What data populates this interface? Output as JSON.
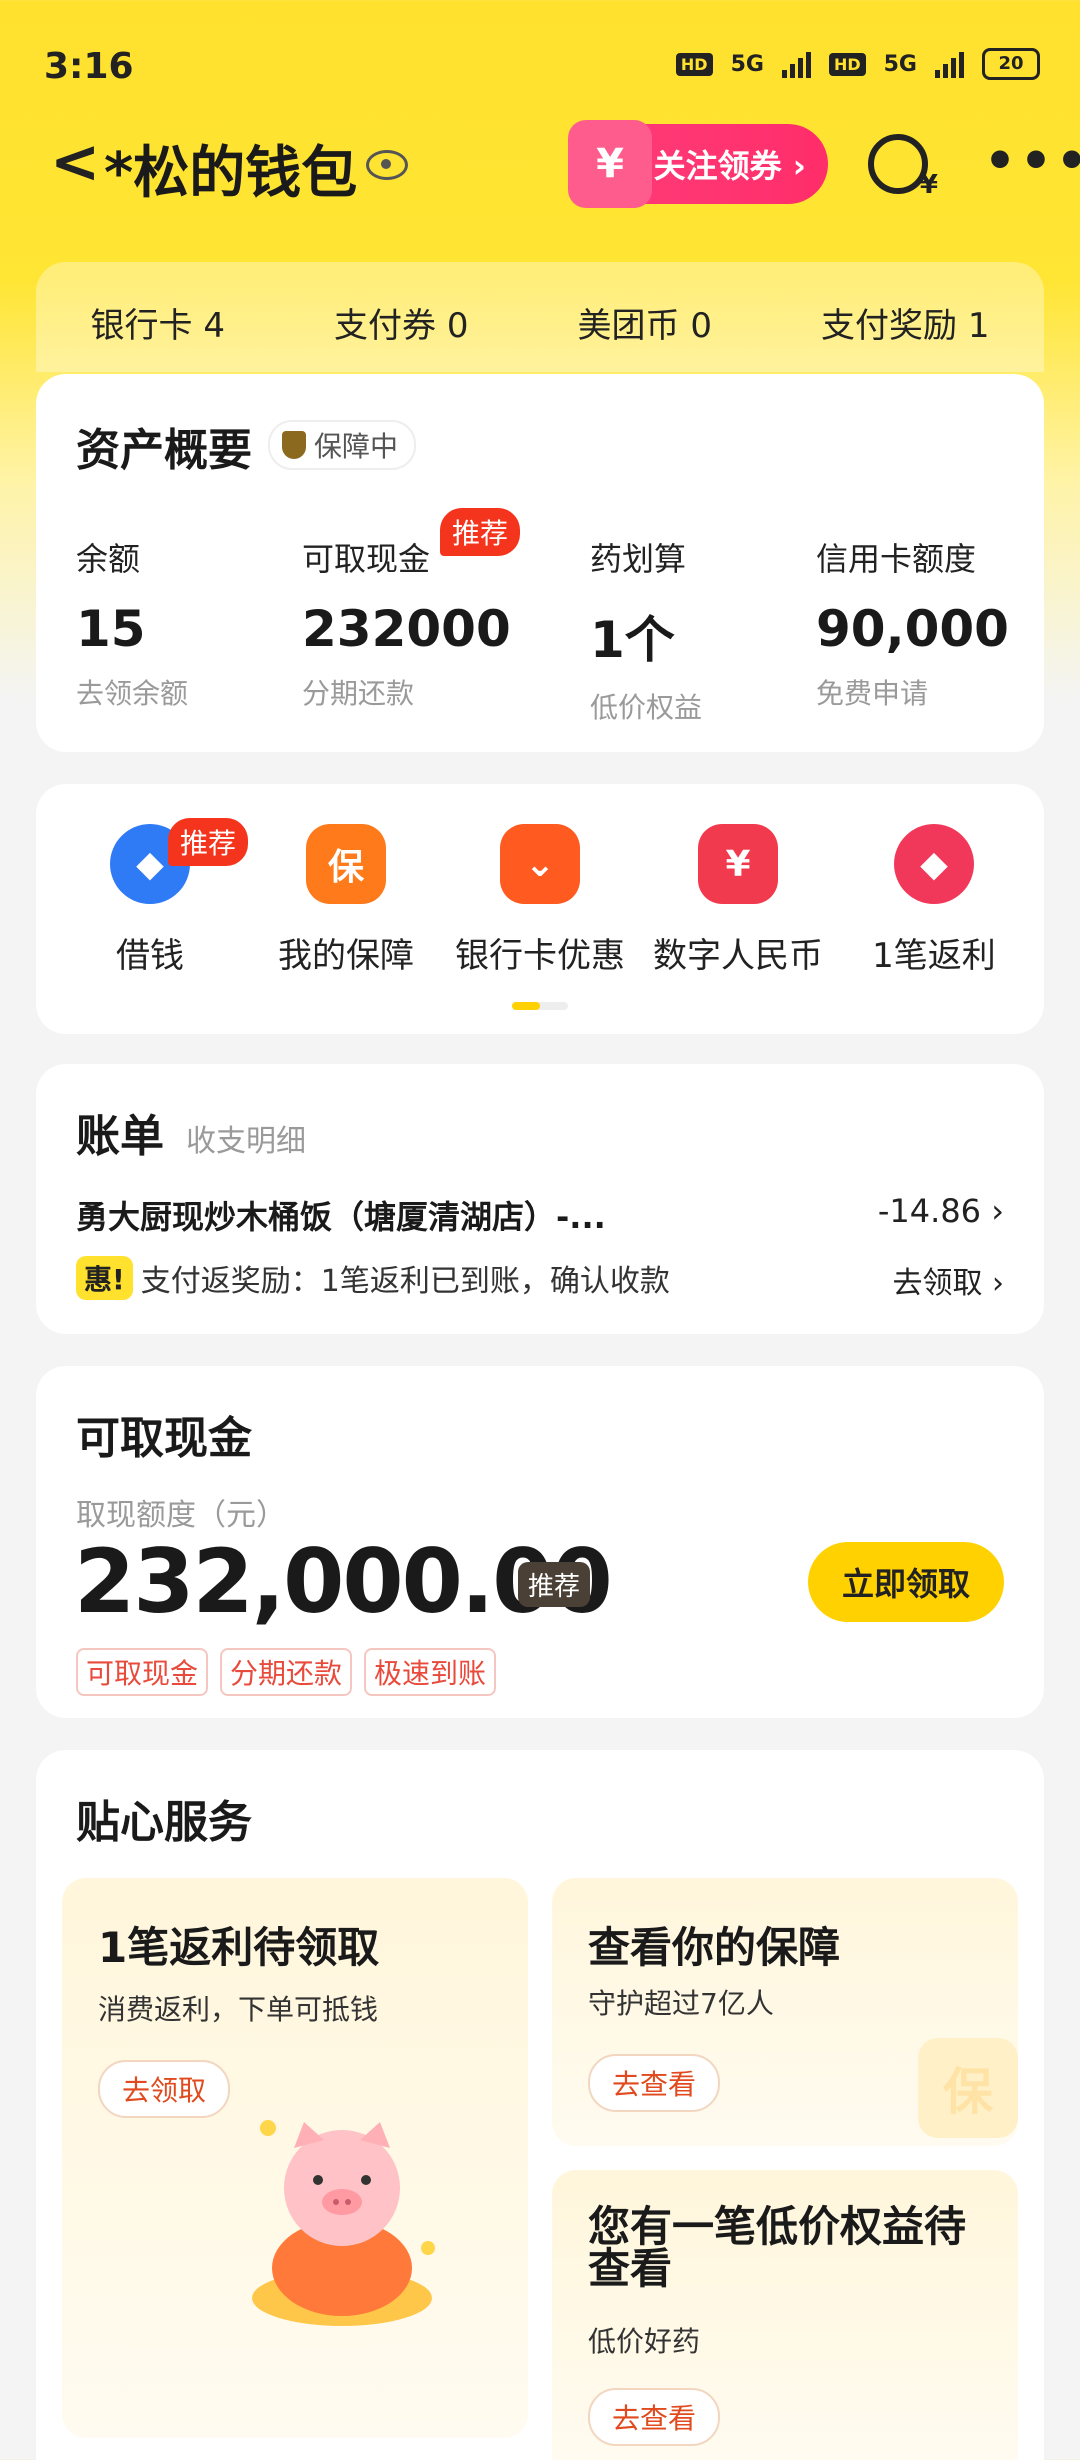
{
  "status": {
    "time": "3:16",
    "net1": "5G",
    "net2": "5G",
    "hd": "HD",
    "battery": "20"
  },
  "header": {
    "title": "*松的钱包",
    "follow_label": "关注领券 ›",
    "follow_icon": "¥",
    "more": "•••",
    "back": "<"
  },
  "tabs": [
    {
      "label": "银行卡 4"
    },
    {
      "label": "支付券 0"
    },
    {
      "label": "美团币 0"
    },
    {
      "label": "支付奖励 1"
    }
  ],
  "assets": {
    "title": "资产概要",
    "guard_badge": "保障中",
    "items": [
      {
        "label": "余额",
        "value": "15",
        "sub": "去领余额"
      },
      {
        "label": "可取现金",
        "value": "232000",
        "sub": "分期还款",
        "tag": "推荐"
      },
      {
        "label": "药划算",
        "value": "1个",
        "sub": "低价权益"
      },
      {
        "label": "信用卡额度",
        "value": "90,000",
        "sub": "免费申请"
      }
    ]
  },
  "shortcuts": [
    {
      "label": "借钱",
      "tag": "推荐",
      "color": "#2F7BF5",
      "glyph": "◆"
    },
    {
      "label": "我的保障",
      "color": "#FF7A1A",
      "glyph": "保"
    },
    {
      "label": "银行卡优惠",
      "color": "#FF5A1F",
      "glyph": "⌄"
    },
    {
      "label": "数字人民币",
      "color": "#F23A4E",
      "glyph": "¥"
    },
    {
      "label": "1笔返利",
      "color": "#F2385A",
      "glyph": "◆"
    }
  ],
  "bill": {
    "title": "账单",
    "subtitle": "收支明细",
    "merchant": "勇大厨现炒木桶饭（塘厦清湖店）-...",
    "amount": "-14.86",
    "promo_tag": "惠!",
    "promo_text": "支付返奖励：1笔返利已到账，确认收款",
    "promo_action": "去领取"
  },
  "cash": {
    "title": "可取现金",
    "sub": "取现额度（元）",
    "amount": "232,000.00",
    "tag": "推荐",
    "button": "立即领取",
    "chips": [
      "可取现金",
      "分期还款",
      "极速到账"
    ]
  },
  "services": {
    "title": "贴心服务",
    "cards": [
      {
        "title": "1笔返利待领取",
        "desc": "消费返利，下单可抵钱",
        "action": "去领取"
      },
      {
        "title": "查看你的保障",
        "desc": "守护超过7亿人",
        "action": "去查看"
      },
      {
        "title": "您有一笔低价权益待查看",
        "desc": "低价好药",
        "action": "去查看"
      }
    ]
  }
}
